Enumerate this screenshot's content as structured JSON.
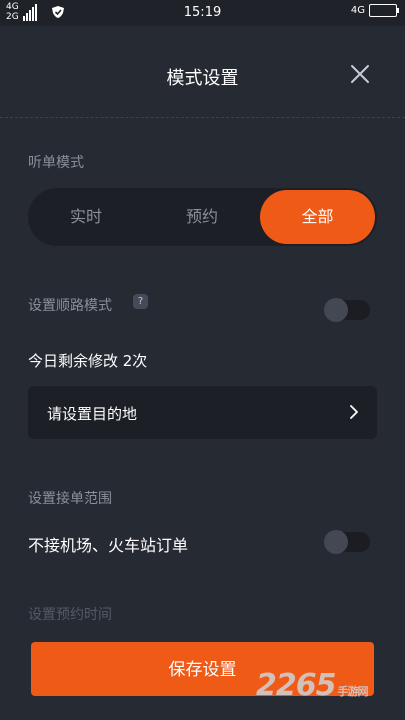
{
  "status_bar": {
    "net_top": "4G",
    "net_bottom": "2G",
    "time": "15:19",
    "right_net": "4G"
  },
  "header": {
    "title": "模式设置"
  },
  "listen_mode": {
    "label": "听单模式",
    "options": [
      "实时",
      "预约",
      "全部"
    ],
    "selected": "全部"
  },
  "route_mode": {
    "label": "设置顺路模式",
    "help": "?",
    "enabled": false,
    "remaining": "今日剩余修改 2次",
    "destination_placeholder": "请设置目的地"
  },
  "range": {
    "label": "设置接单范围",
    "exclude_label": "不接机场、火车站订单",
    "exclude_enabled": false
  },
  "next_section_label": "设置预约时间",
  "save_button": "保存设置",
  "watermark": {
    "main": "2265",
    "sub": "手游网"
  },
  "colors": {
    "accent": "#f05a17",
    "background": "#262a33",
    "surface": "#1c1f26"
  }
}
